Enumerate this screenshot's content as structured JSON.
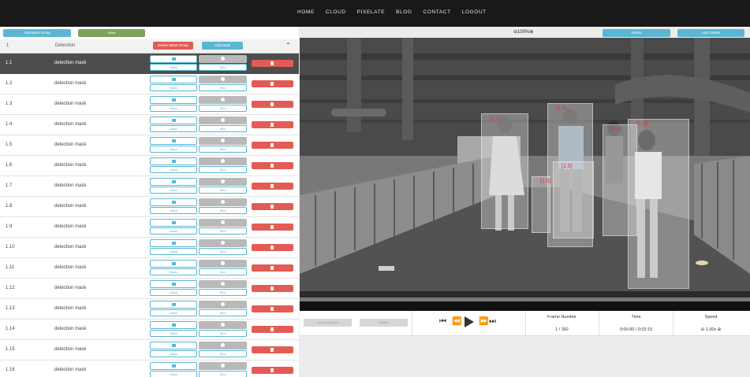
{
  "nav": {
    "links": [
      "HOME",
      "CLOUD",
      "PIXELATE",
      "BLOG",
      "CONTACT",
      "LOGOUT"
    ]
  },
  "toolbar": {
    "add_mask_group": "Add Mask Group",
    "save": "Save",
    "delete_mask_group": "Delete Mask Group",
    "add_mask": "Add Mask"
  },
  "table_header": {
    "id": "1",
    "label": "Detection"
  },
  "row_button_labels": {
    "mask": "Mask",
    "blur": "Blur"
  },
  "rows": [
    {
      "id": "1.1",
      "name": "detection mask"
    },
    {
      "id": "1.2",
      "name": "detection mask"
    },
    {
      "id": "1.3",
      "name": "detection mask"
    },
    {
      "id": "1.4",
      "name": "detection mask"
    },
    {
      "id": "1.5",
      "name": "detection mask"
    },
    {
      "id": "1.6",
      "name": "detection mask"
    },
    {
      "id": "1.7",
      "name": "detection mask"
    },
    {
      "id": "1.8",
      "name": "detection mask"
    },
    {
      "id": "1.9",
      "name": "detection mask"
    },
    {
      "id": "1.10",
      "name": "detection mask"
    },
    {
      "id": "1.11",
      "name": "detection mask"
    },
    {
      "id": "1.12",
      "name": "detection mask"
    },
    {
      "id": "1.13",
      "name": "detection mask"
    },
    {
      "id": "1.14",
      "name": "detection mask"
    },
    {
      "id": "1.15",
      "name": "detection mask"
    },
    {
      "id": "1.16",
      "name": "detection mask"
    }
  ],
  "viewer": {
    "zoom": "100%",
    "detect_button": "Detect",
    "auto_detect_button": "Auto Detect",
    "detections": [
      {
        "label": "[1.1]"
      },
      {
        "label": "[1.2]"
      },
      {
        "label": "[1.3]"
      },
      {
        "label": "[1.4]"
      },
      {
        "label": "[1.5]"
      },
      {
        "label": "[1.6]"
      }
    ]
  },
  "controls": {
    "add_keyframe": "Add Keyframe",
    "delete": "Delete",
    "frame_number_label": "Frame Number",
    "frame_number_value": "1 / 392",
    "time_label": "Time",
    "time_value": "0:00:00 / 0:03:15",
    "speed_label": "Speed",
    "speed_value": "1.00x"
  }
}
